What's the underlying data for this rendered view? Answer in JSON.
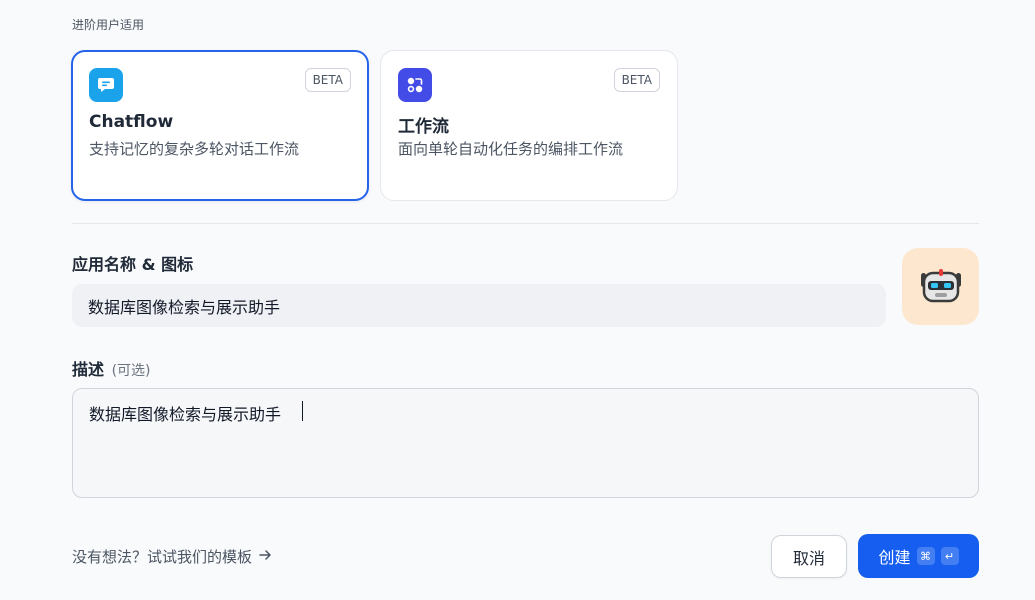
{
  "section_caption": "进阶用户适用",
  "cards": [
    {
      "title": "Chatflow",
      "description": "支持记忆的复杂多轮对话工作流",
      "badge": "BETA",
      "icon": "chatflow-icon",
      "icon_color": "#1aa3ea",
      "selected": true
    },
    {
      "title": "工作流",
      "description": "面向单轮自动化任务的编排工作流",
      "badge": "BETA",
      "icon": "workflow-icon",
      "icon_color": "#444ce7",
      "selected": false
    }
  ],
  "name_field": {
    "label": "应用名称 & 图标",
    "value": "数据库图像检索与展示助手",
    "avatar_icon": "robot-icon",
    "avatar_bg": "#fde7cf"
  },
  "description_field": {
    "label": "描述",
    "optional": "(可选)",
    "value": "数据库图像检索与展示助手"
  },
  "footer": {
    "template_link": "没有想法？试试我们的模板",
    "template_arrow_icon": "arrow-right-icon",
    "cancel_label": "取消",
    "create_label": "创建",
    "shortcut_keys": [
      "⌘",
      "↵"
    ]
  },
  "colors": {
    "accent": "#155eef",
    "selected_border": "#2563eb"
  }
}
